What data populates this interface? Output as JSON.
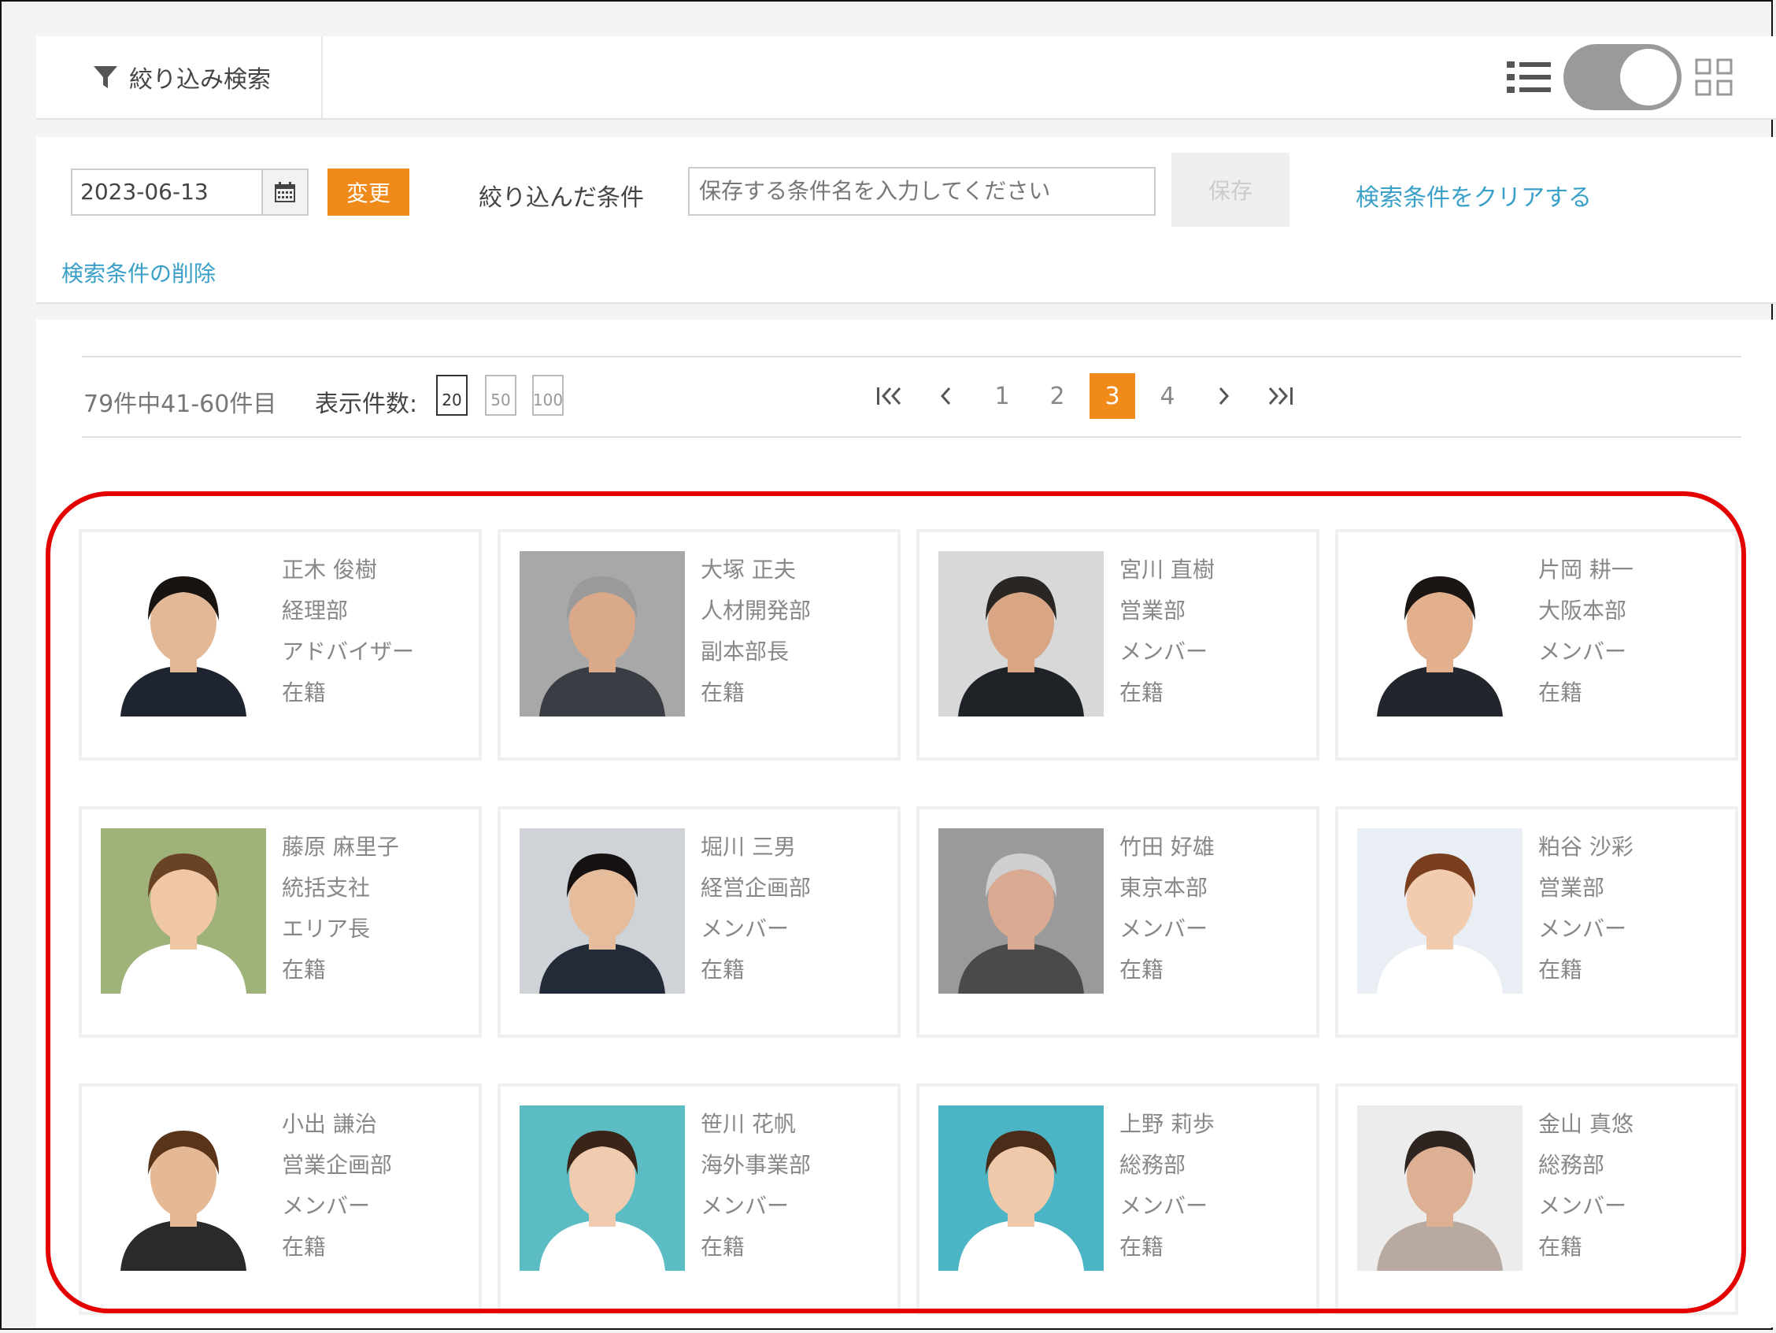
{
  "filter_tab": {
    "label": "絞り込み検索",
    "icon": "funnel-icon"
  },
  "view_toggle": {
    "mode": "grid",
    "list_icon": "list-icon",
    "grid_icon": "grid-icon"
  },
  "conditions": {
    "date_value": "2023-06-13",
    "change_label": "変更",
    "narrowed_label": "絞り込んだ条件",
    "save_placeholder": "保存する条件名を入力してください",
    "save_label": "保存",
    "clear_link": "検索条件をクリアする",
    "delete_link": "検索条件の削除"
  },
  "results": {
    "count_text": "79件中41-60件目",
    "per_page_label": "表示件数:",
    "per_page_options": [
      "20",
      "50",
      "100"
    ],
    "per_page_selected": "20",
    "pagination": {
      "first": "first-page-icon",
      "prev": "prev-page-icon",
      "pages": [
        "1",
        "2",
        "3",
        "4"
      ],
      "current": "3",
      "next": "next-page-icon",
      "last": "last-page-icon"
    }
  },
  "employees": [
    {
      "name": "正木 俊樹",
      "dept": "経理部",
      "role": "アドバイザー",
      "status": "在籍",
      "bg": "#ffffff",
      "shirt": "#1e2430",
      "skin": "#e3b896",
      "hair": "#1a1410"
    },
    {
      "name": "大塚 正夫",
      "dept": "人材開発部",
      "role": "副本部長",
      "status": "在籍",
      "bg": "#a8a8a8",
      "shirt": "#3a3d44",
      "skin": "#d9a98a",
      "hair": "#9a9a9a"
    },
    {
      "name": "宮川 直樹",
      "dept": "営業部",
      "role": "メンバー",
      "status": "在籍",
      "bg": "#d8d8d8",
      "shirt": "#1f2328",
      "skin": "#d8a585",
      "hair": "#2a2624"
    },
    {
      "name": "片岡 耕一",
      "dept": "大阪本部",
      "role": "メンバー",
      "status": "在籍",
      "bg": "#ffffff",
      "shirt": "#22262c",
      "skin": "#e2b08d",
      "hair": "#1b1614"
    },
    {
      "name": "藤原 麻里子",
      "dept": "統括支社",
      "role": "エリア長",
      "status": "在籍",
      "bg": "#9fb27a",
      "shirt": "#ffffff",
      "skin": "#f0c7a5",
      "hair": "#6a4226"
    },
    {
      "name": "堀川 三男",
      "dept": "経営企画部",
      "role": "メンバー",
      "status": "在籍",
      "bg": "#cfd3d8",
      "shirt": "#232a38",
      "skin": "#e5bd9c",
      "hair": "#151211"
    },
    {
      "name": "竹田 好雄",
      "dept": "東京本部",
      "role": "メンバー",
      "status": "在籍",
      "bg": "#9a9a9a",
      "shirt": "#4a4a4a",
      "skin": "#d9a991",
      "hair": "#cfcfcf"
    },
    {
      "name": "粕谷 沙彩",
      "dept": "営業部",
      "role": "メンバー",
      "status": "在籍",
      "bg": "#e8eef4",
      "shirt": "#ffffff",
      "skin": "#f1ccae",
      "hair": "#7a3e1e"
    },
    {
      "name": "小出 謙治",
      "dept": "営業企画部",
      "role": "メンバー",
      "status": "在籍",
      "bg": "#ffffff",
      "shirt": "#2a2a2a",
      "skin": "#e6b996",
      "hair": "#5a3418"
    },
    {
      "name": "笹川 花帆",
      "dept": "海外事業部",
      "role": "メンバー",
      "status": "在籍",
      "bg": "#5bbcc4",
      "shirt": "#ffffff",
      "skin": "#f1cbb0",
      "hair": "#3a2418"
    },
    {
      "name": "上野 莉歩",
      "dept": "総務部",
      "role": "メンバー",
      "status": "在籍",
      "bg": "#4bb5c5",
      "shirt": "#ffffff",
      "skin": "#f0c9aa",
      "hair": "#4a2c18"
    },
    {
      "name": "金山 真悠",
      "dept": "総務部",
      "role": "メンバー",
      "status": "在籍",
      "bg": "#ececec",
      "shirt": "#b8aaa0",
      "skin": "#ddb094",
      "hair": "#2e2420"
    }
  ],
  "colors": {
    "accent": "#f08a18",
    "link": "#3aa0c8",
    "highlight": "#e50000"
  }
}
